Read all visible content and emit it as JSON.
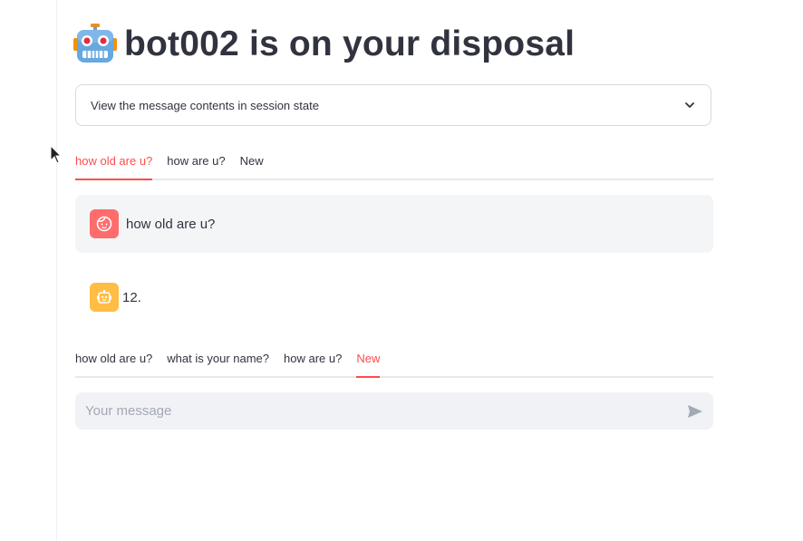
{
  "header": {
    "icon": "robot-face-icon",
    "title": "bot002 is on your disposal"
  },
  "expander": {
    "label": "View the message contents in session state",
    "icon": "chevron-down-icon"
  },
  "top_tabs": [
    {
      "label": "how old are u?",
      "active": true
    },
    {
      "label": "how are u?",
      "active": false
    },
    {
      "label": "New",
      "active": false
    }
  ],
  "messages": [
    {
      "role": "user",
      "avatar": "user-face-icon",
      "text": "how old are u?"
    },
    {
      "role": "assistant",
      "avatar": "bot-icon",
      "text": "12."
    }
  ],
  "bottom_tabs": [
    {
      "label": "how old are u?",
      "active": false
    },
    {
      "label": "what is your name?",
      "active": false
    },
    {
      "label": "how are u?",
      "active": false
    },
    {
      "label": "New",
      "active": true
    }
  ],
  "chat_input": {
    "placeholder": "Your message",
    "value": "",
    "send_icon": "send-icon"
  },
  "colors": {
    "accent": "#ff4b4b",
    "user_avatar": "#ff6c6c",
    "bot_avatar": "#ffbd45",
    "text": "#31333f"
  }
}
